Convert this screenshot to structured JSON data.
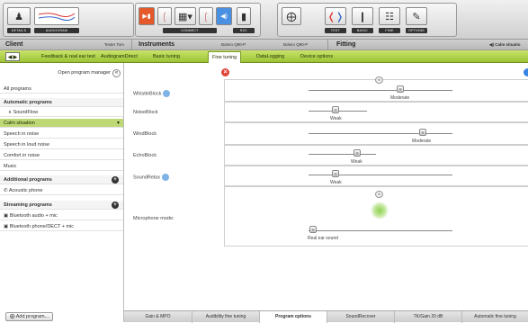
{
  "toolbar": {
    "details_label": "DETAILS",
    "audiogram_label": "AUDIOGRAM",
    "connect_label": "CONNECT",
    "r2c_label": "R2C",
    "test_label": "TEST",
    "basic_label": "BASIC",
    "fine_label": "FINE",
    "options_label": "OPTIONS"
  },
  "header": {
    "client_title": "Client",
    "client_name": "Tester Tom",
    "instruments_title": "Instruments",
    "device_left": "Bolero Q90-P",
    "device_right": "Bolero Q90-P",
    "fitting_title": "Fitting",
    "program_status": "◀) Calm situatio"
  },
  "nav": {
    "arrows": "◀ ▶",
    "tabs": [
      "Feedback & real ear test",
      "AudiogramDirect",
      "Basic tuning",
      "Fine tuning",
      "DataLogging",
      "Device options"
    ],
    "active": "Fine tuning"
  },
  "sidebar": {
    "manager_label": "Open program manager",
    "all_programs": "All programs",
    "automatic_header": "Automatic programs",
    "soundflow": "SoundFlow",
    "calm": "Calm situation",
    "speech_noise": "Speech in noise",
    "speech_loud": "Speech in loud noise",
    "comfort": "Comfort in noise",
    "music": "Music",
    "additional_header": "Additional programs",
    "acoustic_phone": "Acoustic phone",
    "streaming_header": "Streaming programs",
    "bt_audio": "Bluetooth audio + mic",
    "bt_phone": "Bluetooth phone/DECT + mic",
    "add_program": "Add program..."
  },
  "controls": {
    "whistleblock": {
      "label": "WhistleBlock",
      "value": "Moderate"
    },
    "noiseblock": {
      "label": "NoiseBlock",
      "value": "Weak"
    },
    "windblock": {
      "label": "WindBlock",
      "value": "Moderate"
    },
    "echoblock": {
      "label": "EchoBlock",
      "value": "Weak"
    },
    "soundrelax": {
      "label": "SoundRelax",
      "value": "Weak"
    },
    "microphone": {
      "label": "Microphone mode:",
      "value": "Real ear sound"
    }
  },
  "bottom_tabs": [
    "Gain & MPO",
    "Audibility fine tuning",
    "Program options",
    "SoundRecover",
    "TK/Gain 20 dB",
    "Automatic fine tuning"
  ],
  "bottom_active": "Program options",
  "colors": {
    "accent_green": "#9dc336",
    "selection": "#bed876",
    "left_red": "#e0463a",
    "right_blue": "#3a86e0"
  }
}
